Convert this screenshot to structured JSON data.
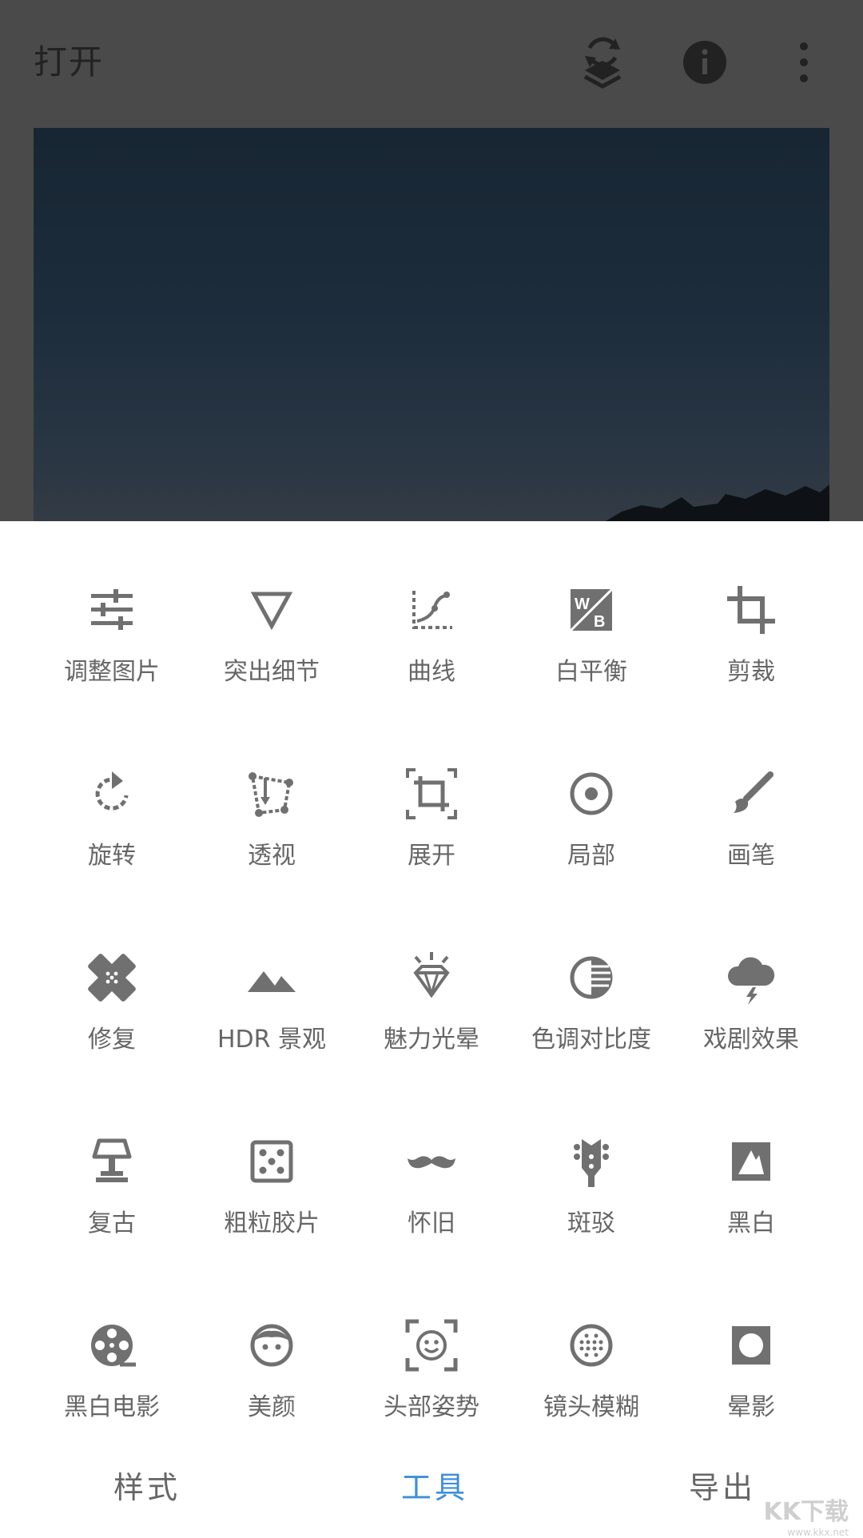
{
  "header": {
    "title": "打开",
    "icons": [
      "layers-rotate-icon",
      "info-icon",
      "more-vertical-icon"
    ]
  },
  "colors": {
    "dim_overlay": "#4a4a4a",
    "icon_gray": "#707070",
    "label_gray": "#666666",
    "active_tab": "#3d8fdc"
  },
  "tools": [
    {
      "label": "调整图片",
      "icon": "tune-sliders-icon"
    },
    {
      "label": "突出细节",
      "icon": "triangle-down-icon"
    },
    {
      "label": "曲线",
      "icon": "curves-icon"
    },
    {
      "label": "白平衡",
      "icon": "white-balance-icon"
    },
    {
      "label": "剪裁",
      "icon": "crop-icon"
    },
    {
      "label": "旋转",
      "icon": "rotate-icon"
    },
    {
      "label": "透视",
      "icon": "perspective-icon"
    },
    {
      "label": "展开",
      "icon": "expand-icon"
    },
    {
      "label": "局部",
      "icon": "selective-icon"
    },
    {
      "label": "画笔",
      "icon": "brush-icon"
    },
    {
      "label": "修复",
      "icon": "healing-bandage-icon"
    },
    {
      "label": "HDR 景观",
      "icon": "mountains-icon"
    },
    {
      "label": "魅力光晕",
      "icon": "diamond-glow-icon"
    },
    {
      "label": "色调对比度",
      "icon": "tonal-contrast-icon"
    },
    {
      "label": "戏剧效果",
      "icon": "storm-cloud-icon"
    },
    {
      "label": "复古",
      "icon": "lamp-icon"
    },
    {
      "label": "粗粒胶片",
      "icon": "grain-dice-icon"
    },
    {
      "label": "怀旧",
      "icon": "mustache-icon"
    },
    {
      "label": "斑驳",
      "icon": "guitar-head-icon"
    },
    {
      "label": "黑白",
      "icon": "black-white-icon"
    },
    {
      "label": "黑白电影",
      "icon": "film-reel-icon"
    },
    {
      "label": "美颜",
      "icon": "face-icon"
    },
    {
      "label": "头部姿势",
      "icon": "face-frame-icon"
    },
    {
      "label": "镜头模糊",
      "icon": "lens-blur-icon"
    },
    {
      "label": "晕影",
      "icon": "vignette-icon"
    }
  ],
  "nav": {
    "styles": "样式",
    "tools": "工具",
    "export": "导出",
    "active": "tools"
  },
  "watermark": {
    "main": "KK下载",
    "url": "www.kkx.net"
  }
}
